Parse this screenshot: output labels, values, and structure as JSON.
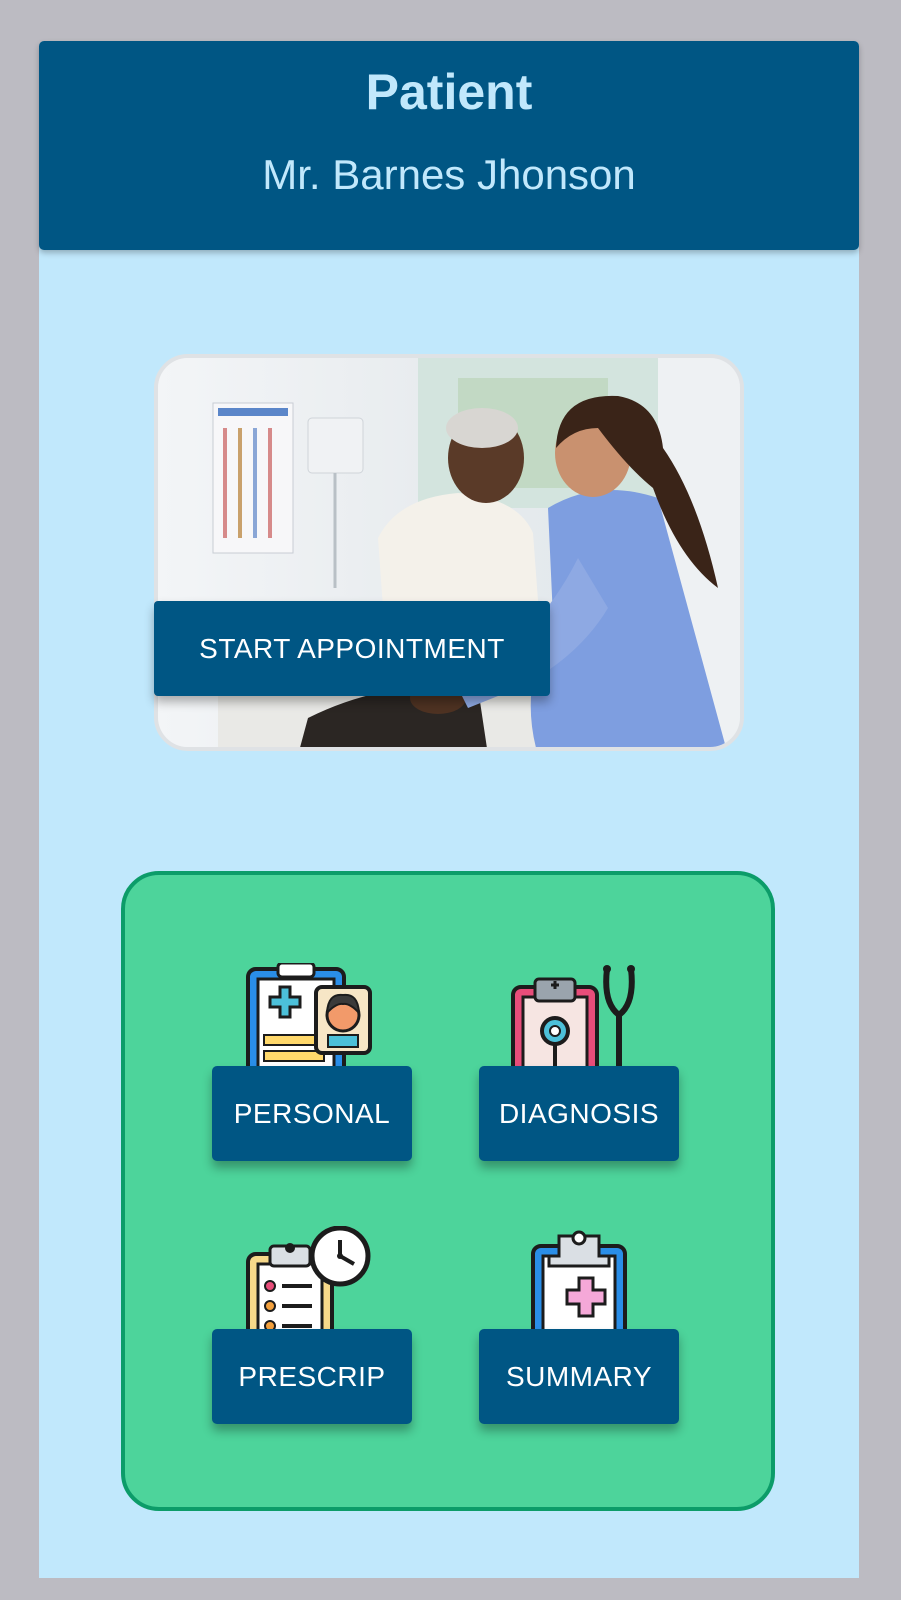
{
  "header": {
    "title": "Patient",
    "patient_name": "Mr. Barnes Jhonson"
  },
  "appointment": {
    "start_label": "START APPOINTMENT",
    "photo": "doctor-patient-photo"
  },
  "menu": {
    "tiles": [
      {
        "label": "PERSONAL",
        "icon": "patient-record-icon"
      },
      {
        "label": "DIAGNOSIS",
        "icon": "stethoscope-clipboard-icon"
      },
      {
        "label": "PRESCRIP",
        "icon": "prescription-clock-icon"
      },
      {
        "label": "SUMMARY",
        "icon": "medical-summary-icon"
      }
    ]
  },
  "colors": {
    "header": "#005684",
    "background": "#c1e8fc",
    "panel": "#4dd49b",
    "panel_border": "#0c9c69",
    "button": "#005684"
  }
}
